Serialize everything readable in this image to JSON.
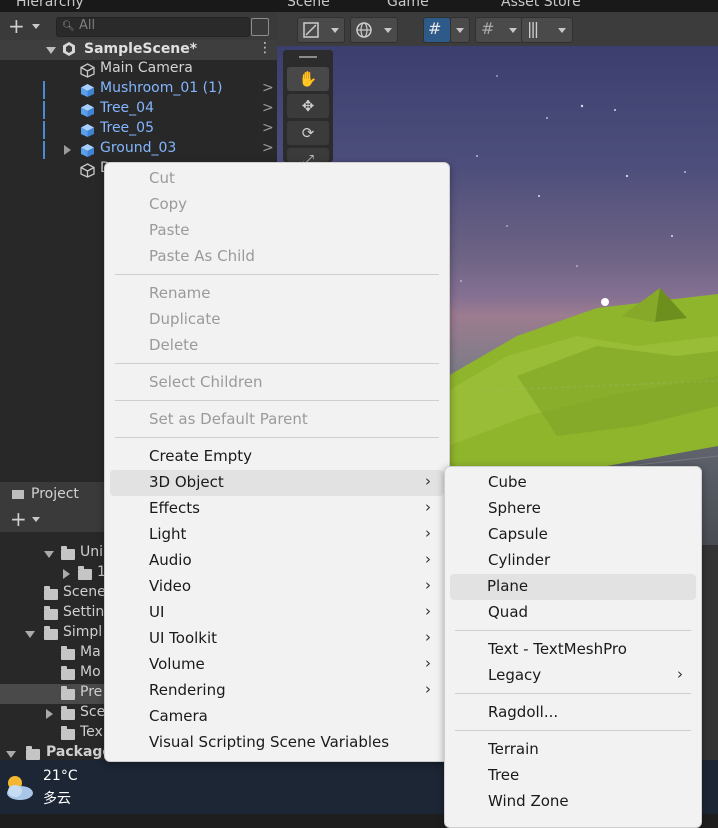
{
  "hierarchy": {
    "tab_label": "Hierarchy",
    "search_placeholder": "All",
    "scene_name": "SampleScene*",
    "items": [
      {
        "label": "Main Camera",
        "prefab": false
      },
      {
        "label": "Mushroom_01 (1)",
        "prefab": true
      },
      {
        "label": "Tree_04",
        "prefab": true
      },
      {
        "label": "Tree_05",
        "prefab": true
      },
      {
        "label": "Ground_03",
        "prefab": true
      },
      {
        "label": "D",
        "prefab": false
      }
    ]
  },
  "project": {
    "tab_label": "Project",
    "tree": [
      {
        "label": "Uni"
      },
      {
        "label": "1"
      },
      {
        "label": "Scene"
      },
      {
        "label": "Settin"
      },
      {
        "label": "Simpl"
      },
      {
        "label": "Ma"
      },
      {
        "label": "Mo"
      },
      {
        "label": "Pre"
      },
      {
        "label": "Sce"
      },
      {
        "label": "Tex"
      },
      {
        "label": "Package"
      }
    ]
  },
  "scene_view": {
    "tabs": [
      "Scene",
      "Game",
      "Asset Store"
    ]
  },
  "context_menu": {
    "group1": [
      "Cut",
      "Copy",
      "Paste",
      "Paste As Child"
    ],
    "group2": [
      "Rename",
      "Duplicate",
      "Delete"
    ],
    "group3": [
      "Select Children"
    ],
    "group4": [
      "Set as Default Parent"
    ],
    "group5": [
      "Create Empty",
      "3D Object",
      "Effects",
      "Light",
      "Audio",
      "Video",
      "UI",
      "UI Toolkit",
      "Volume",
      "Rendering",
      "Camera",
      "Visual Scripting Scene Variables"
    ],
    "arrow": "›"
  },
  "submenu_3d": {
    "group1": [
      "Cube",
      "Sphere",
      "Capsule",
      "Cylinder",
      "Plane",
      "Quad"
    ],
    "group2": [
      "Text - TextMeshPro",
      "Legacy"
    ],
    "group3": [
      "Ragdoll..."
    ],
    "group4": [
      "Terrain",
      "Tree",
      "Wind Zone"
    ]
  },
  "taskbar": {
    "temperature": "21°C",
    "weather": "多云"
  },
  "colors": {
    "menu_bg": "#f2f2f2",
    "highlight": "#e2e2e2",
    "prefab_text": "#83b6ff",
    "ground": "#8fb52d"
  }
}
